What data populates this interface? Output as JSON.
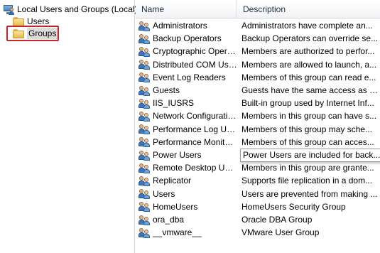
{
  "tree": {
    "root_label": "Local Users and Groups (Local)",
    "items": [
      {
        "label": "Users"
      },
      {
        "label": "Groups"
      }
    ]
  },
  "columns": {
    "name": "Name",
    "description": "Description"
  },
  "groups": [
    {
      "name": "Administrators",
      "description": "Administrators have complete an..."
    },
    {
      "name": "Backup Operators",
      "description": "Backup Operators can override se..."
    },
    {
      "name": "Cryptographic Operat...",
      "description": "Members are authorized to perfor..."
    },
    {
      "name": "Distributed COM Users",
      "description": "Members are allowed to launch, a..."
    },
    {
      "name": "Event Log Readers",
      "description": "Members of this group can read e..."
    },
    {
      "name": "Guests",
      "description": "Guests have the same access as m..."
    },
    {
      "name": "IIS_IUSRS",
      "description": "Built-in group used by Internet Inf..."
    },
    {
      "name": "Network Configuratio...",
      "description": "Members in this group can have s..."
    },
    {
      "name": "Performance Log Users",
      "description": "Members of this group may sche..."
    },
    {
      "name": "Performance Monitor ...",
      "description": "Members of this group can acces..."
    },
    {
      "name": "Power Users",
      "description": ""
    },
    {
      "name": "Remote Desktop Users",
      "description": "Members in this group are grante..."
    },
    {
      "name": "Replicator",
      "description": "Supports file replication in a dom..."
    },
    {
      "name": "Users",
      "description": "Users are prevented from making ..."
    },
    {
      "name": "HomeUsers",
      "description": "HomeUsers Security Group"
    },
    {
      "name": "ora_dba",
      "description": "Oracle DBA Group"
    },
    {
      "name": "__vmware__",
      "description": "VMware User Group"
    }
  ],
  "tooltip": "Power Users are included for back...",
  "icons": {
    "root": "computer-users-icon",
    "folder": "folder-icon",
    "group": "group-icon"
  },
  "colors": {
    "highlight_box": "#c8242b",
    "header_text": "#1e2f44"
  }
}
